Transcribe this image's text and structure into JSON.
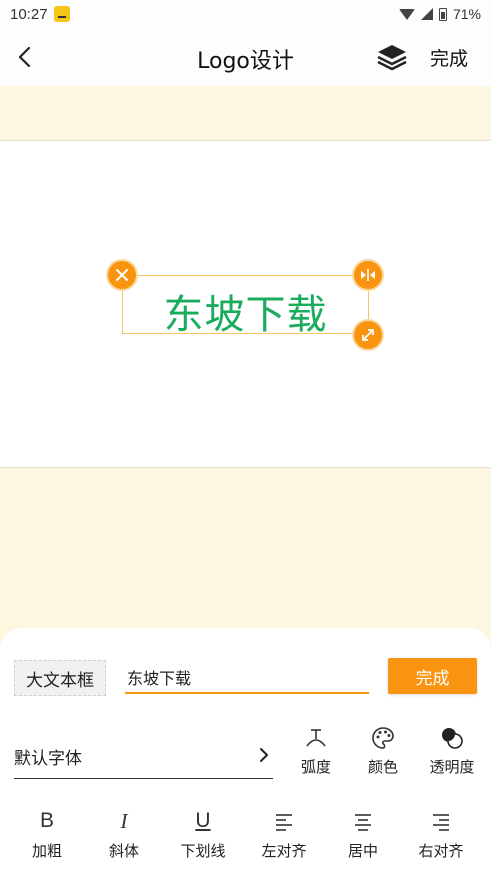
{
  "status_bar": {
    "time": "10:27",
    "battery": "71%"
  },
  "header": {
    "title": "Logo设计",
    "done_label": "完成"
  },
  "canvas": {
    "logo_text": "东坡下载",
    "logo_color": "#1bab5c"
  },
  "editor": {
    "text_type_label": "大文本框",
    "text_value": "东坡下载",
    "done_label": "完成",
    "font_label": "默认字体",
    "tools": [
      {
        "label": "弧度",
        "icon": "arc-icon"
      },
      {
        "label": "颜色",
        "icon": "palette-icon"
      },
      {
        "label": "透明度",
        "icon": "opacity-icon"
      }
    ],
    "format": [
      {
        "label": "加粗",
        "glyph": "B",
        "icon": "bold-icon"
      },
      {
        "label": "斜体",
        "glyph": "I",
        "icon": "italic-icon"
      },
      {
        "label": "下划线",
        "glyph": "U",
        "icon": "underline-icon"
      },
      {
        "label": "左对齐",
        "icon": "align-left-icon"
      },
      {
        "label": "居中",
        "icon": "align-center-icon"
      },
      {
        "label": "右对齐",
        "icon": "align-right-icon"
      }
    ]
  },
  "colors": {
    "accent": "#f99410",
    "canvas_background": "#fdf6e1"
  }
}
